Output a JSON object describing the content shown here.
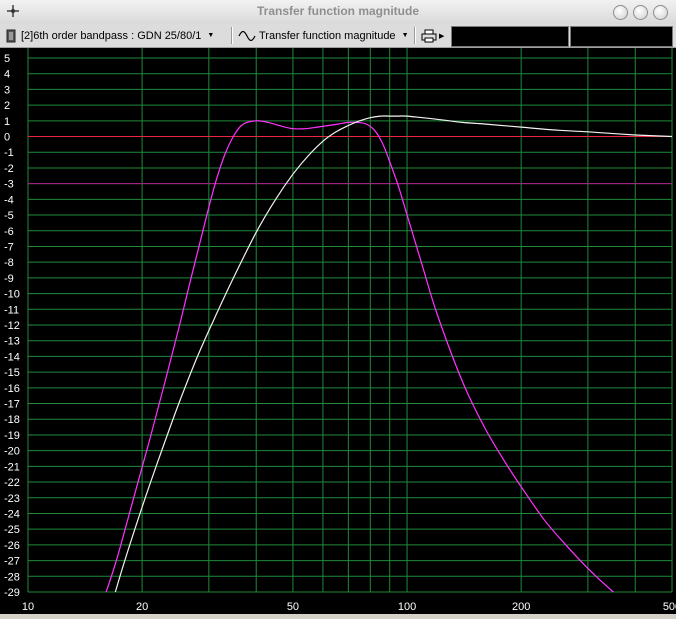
{
  "window": {
    "title": "Transfer function magnitude"
  },
  "toolbar": {
    "design_select": "[2]6th order bandpass : GDN 25/80/1",
    "view_select": "Transfer function magnitude",
    "readout_1": "",
    "readout_2": ""
  },
  "colors": {
    "background": "#000000",
    "grid": "#1f8a3a",
    "axis_text": "#ffffff",
    "reference_0db": "#e8263c",
    "reference_minus3db": "#b0198f",
    "curve_1": "#ff33ff",
    "curve_2": "#f2f2ee"
  },
  "chart_data": {
    "type": "line",
    "title": "Transfer function magnitude",
    "xscale": "log",
    "xlim": [
      10,
      500
    ],
    "ylim": [
      -29,
      5
    ],
    "grid": true,
    "x_ticks_labeled": [
      10,
      20,
      50,
      100,
      200,
      500
    ],
    "x_ticks_minor": [
      30,
      40,
      60,
      70,
      80,
      90,
      300,
      400
    ],
    "y_ticks": [
      5,
      4,
      3,
      2,
      1,
      0,
      -1,
      -2,
      -3,
      -4,
      -5,
      -6,
      -7,
      -8,
      -9,
      -10,
      -11,
      -12,
      -13,
      -14,
      -15,
      -16,
      -17,
      -18,
      -19,
      -20,
      -21,
      -22,
      -23,
      -24,
      -25,
      -26,
      -27,
      -28,
      -29
    ],
    "reference_lines": [
      {
        "y": 0,
        "color": "#e8263c"
      },
      {
        "y": -3,
        "color": "#b0198f"
      }
    ],
    "series": [
      {
        "color": "#ff33ff",
        "x": [
          15.3,
          17,
          19,
          21,
          23,
          25,
          27,
          29,
          31,
          33,
          35,
          37,
          40,
          43,
          46,
          50,
          54,
          58,
          62,
          66,
          70,
          74,
          78,
          82,
          86,
          90,
          95,
          100,
          110,
          120,
          140,
          160,
          180,
          200,
          230,
          260,
          300,
          350,
          400,
          445
        ],
        "y": [
          -30.5,
          -27.2,
          -23,
          -19.2,
          -15.6,
          -12.2,
          -8.9,
          -5.9,
          -3.2,
          -1.2,
          0.1,
          0.8,
          1.0,
          0.9,
          0.7,
          0.5,
          0.5,
          0.6,
          0.7,
          0.8,
          0.9,
          0.9,
          0.8,
          0.4,
          -0.4,
          -1.6,
          -3.2,
          -5.0,
          -8.3,
          -11.3,
          -15.6,
          -18.5,
          -20.6,
          -22.3,
          -24.4,
          -25.9,
          -27.5,
          -29.0,
          -30.1,
          -31.0
        ]
      },
      {
        "color": "#f2f2ee",
        "x": [
          16.3,
          18,
          20,
          22,
          25,
          28,
          31,
          35,
          40,
          45,
          50,
          55,
          60,
          65,
          70,
          75,
          80,
          85,
          90,
          95,
          100,
          110,
          120,
          140,
          160,
          200,
          250,
          300,
          400,
          500
        ],
        "y": [
          -30.5,
          -27.0,
          -23.6,
          -20.7,
          -17.0,
          -14.0,
          -11.6,
          -8.9,
          -6.1,
          -4.0,
          -2.4,
          -1.2,
          -0.3,
          0.3,
          0.7,
          1.0,
          1.2,
          1.3,
          1.3,
          1.3,
          1.3,
          1.2,
          1.1,
          0.9,
          0.8,
          0.6,
          0.4,
          0.3,
          0.1,
          0.0
        ]
      }
    ]
  }
}
